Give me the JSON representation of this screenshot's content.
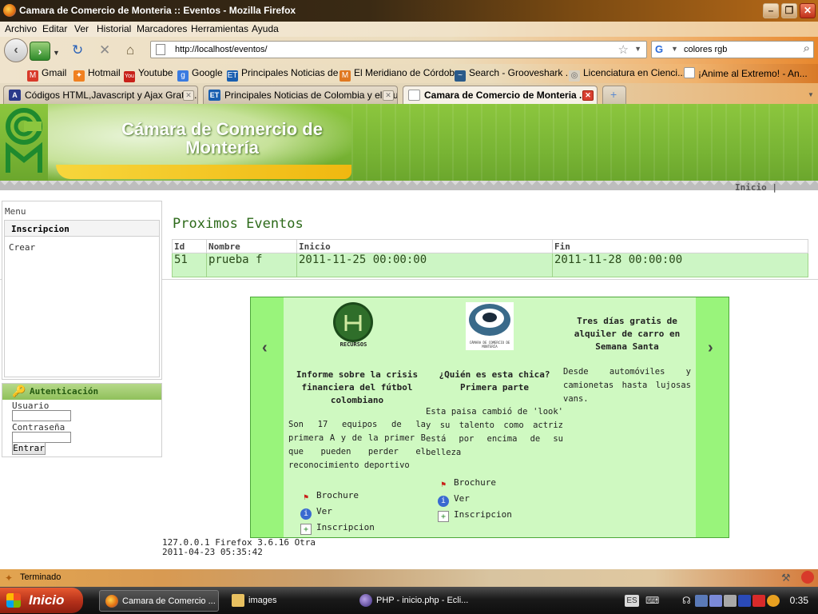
{
  "window": {
    "title": "Camara de Comercio de Monteria :: Eventos - Mozilla Firefox"
  },
  "menubar": [
    "Archivo",
    "Editar",
    "Ver",
    "Historial",
    "Marcadores",
    "Herramientas",
    "Ayuda"
  ],
  "nav": {
    "url": "http://localhost/eventos/",
    "search": "colores rgb"
  },
  "bookmarks": [
    "Gmail",
    "Hotmail",
    "Youtube",
    "Google",
    "Principales Noticias de ...",
    "El Meridiano de Córdob...",
    "Search - Grooveshark ...",
    "Licenciatura en Cienci...",
    "¡Anime al Extremo! - An..."
  ],
  "tabs": [
    {
      "label": "Códigos HTML,Javascript y Ajax Gratuit..."
    },
    {
      "label": "Principales Noticias de Colombia y el Mu..."
    },
    {
      "label": "Camara de Comercio de Monteria ..."
    }
  ],
  "site": {
    "title_line1": "Cámara de Comercio de",
    "title_line2": "Montería",
    "top_link": "Inicio |"
  },
  "sidebar": {
    "menu_label": "Menu",
    "section": "Inscripcion",
    "item": "Crear"
  },
  "auth": {
    "title": "Autenticación",
    "user_label": "Usuario",
    "pass_label": "Contraseña",
    "button": "Entrar"
  },
  "main": {
    "heading": "Proximos Eventos",
    "columns": [
      "Id",
      "Nombre",
      "Inicio",
      "Fin"
    ],
    "rows": [
      {
        "id": "51",
        "nombre": "prueba f",
        "inicio": "2011-11-25 00:00:00",
        "fin": "2011-11-28 00:00:00"
      }
    ]
  },
  "carousel": {
    "prev": "‹",
    "next": "›",
    "slides": [
      {
        "logo": "RECURSOS",
        "title": "Informe sobre la crisis financiera del fútbol colombiano",
        "description": "Son 17 equipos de la primera A y de la primer B que pueden perder el reconocimiento deportivo",
        "links": [
          "Brochure",
          "Ver",
          "Inscripcion"
        ]
      },
      {
        "logo": "CÁMARA DE COMERCIO DE MONTERÍA",
        "title": "¿Quién es esta chica? Primera parte",
        "description": "Esta paisa cambió de 'look' y su talento como actriz está por encima de su belleza",
        "links": [
          "Brochure",
          "Ver",
          "Inscripcion"
        ]
      },
      {
        "title": "Tres días gratis de alquiler de carro en Semana Santa",
        "description": "Desde automóviles y camionetas hasta lujosas vans."
      }
    ]
  },
  "footer": {
    "line1": "127.0.0.1 Firefox 3.6.16 Otra",
    "line2": "2011-04-23 05:35:42"
  },
  "statusbar": {
    "text": "Terminado"
  },
  "taskbar": {
    "start": "Inicio",
    "items": [
      "Camara de Comercio ...",
      "images",
      "PHP - inicio.php - Ecli..."
    ],
    "lang": "ES",
    "clock": "0:35"
  }
}
